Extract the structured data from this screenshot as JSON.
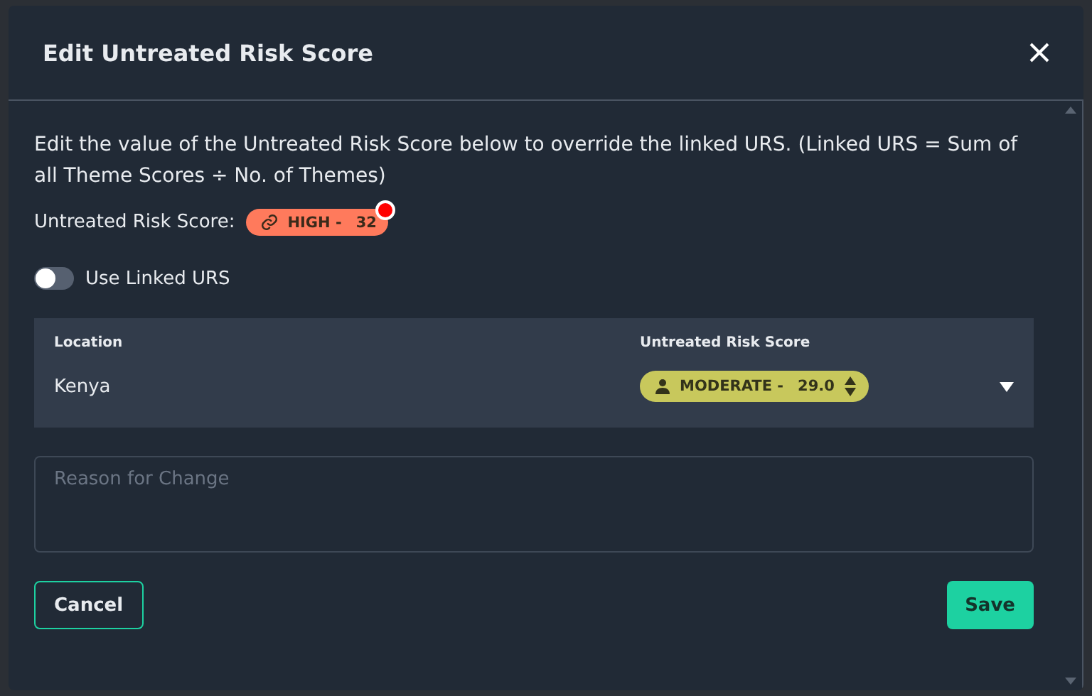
{
  "dialog": {
    "title": "Edit Untreated Risk Score"
  },
  "description": "Edit the value of the Untreated Risk Score below to override the linked URS. (Linked URS = Sum of all Theme Scores ÷ No. of Themes)",
  "current_score": {
    "label": "Untreated Risk Score:",
    "badge": {
      "kind": "linked",
      "level": "HIGH -",
      "score": "32",
      "color": "#ff7a5c",
      "alert": true
    }
  },
  "toggle": {
    "label": "Use Linked URS",
    "on": false
  },
  "table": {
    "columns": [
      "Location",
      "Untreated Risk Score"
    ],
    "rows": [
      {
        "location": "Kenya",
        "score": {
          "kind": "person",
          "level": "MODERATE -",
          "score": "29.0",
          "color": "#c8c85c"
        },
        "expanded": false
      }
    ]
  },
  "reason": {
    "placeholder": "Reason for Change"
  },
  "buttons": [
    {
      "kind": "secondary",
      "label": "Cancel"
    },
    {
      "kind": "primary",
      "label": "Save"
    }
  ]
}
